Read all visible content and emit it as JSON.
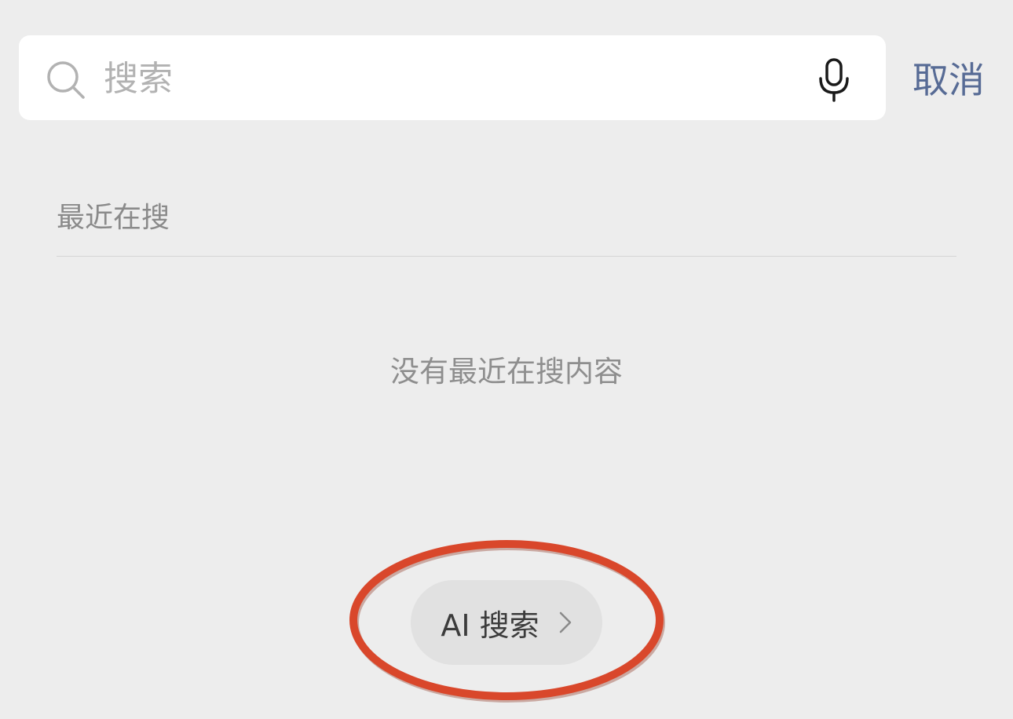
{
  "search": {
    "placeholder": "搜索",
    "value": "",
    "search_icon": "search-icon",
    "mic_icon": "microphone-icon"
  },
  "header": {
    "cancel_label": "取消"
  },
  "recent": {
    "title": "最近在搜",
    "empty_message": "没有最近在搜内容"
  },
  "ai_search": {
    "label": "AI 搜索",
    "chevron_icon": "chevron-right-icon"
  },
  "annotation": {
    "color": "#d9472b"
  },
  "colors": {
    "background": "#ededed",
    "accent_link": "#576b95"
  }
}
